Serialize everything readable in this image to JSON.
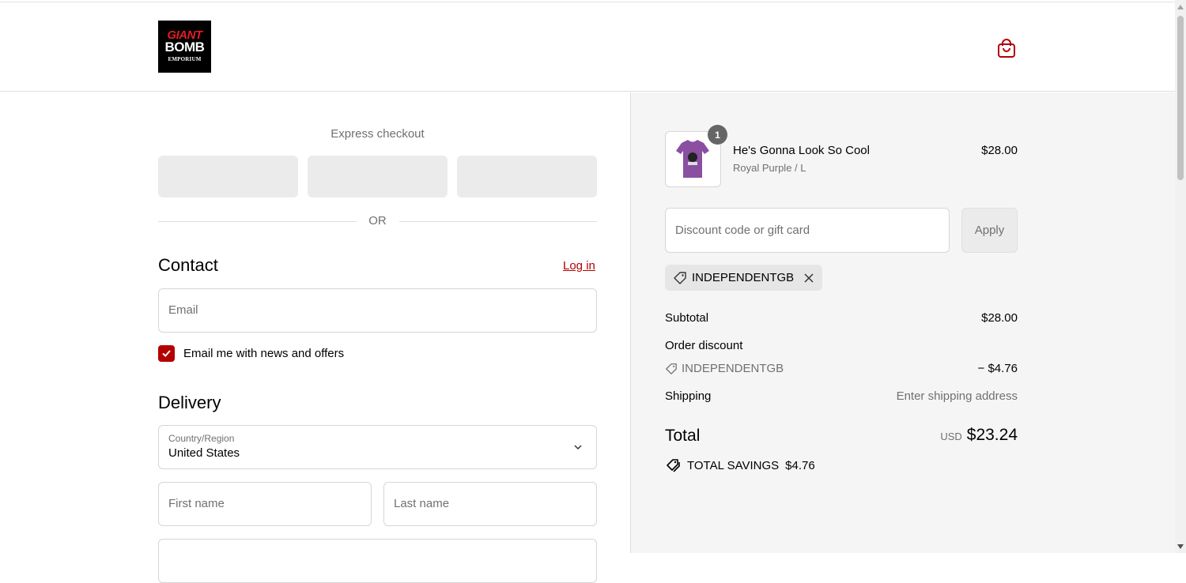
{
  "brand": {
    "logo_line1": "GIANT",
    "logo_line2": "BOMB",
    "logo_line3": "EMPORIUM",
    "accent_color": "#b30000"
  },
  "header": {
    "cart_icon": "shopping-bag-icon"
  },
  "express": {
    "label": "Express checkout",
    "or": "OR"
  },
  "contact": {
    "heading": "Contact",
    "login_label": "Log in",
    "email_placeholder": "Email",
    "newsletter_label": "Email me with news and offers",
    "newsletter_checked": true
  },
  "delivery": {
    "heading": "Delivery",
    "country_label": "Country/Region",
    "country_value": "United States",
    "first_name_placeholder": "First name",
    "last_name_placeholder": "Last name"
  },
  "order": {
    "item": {
      "name": "He's Gonna Look So Cool",
      "variant": "Royal Purple / L",
      "price": "$28.00",
      "quantity": "1"
    },
    "discount_placeholder": "Discount code or gift card",
    "apply_label": "Apply",
    "applied_code": "INDEPENDENTGB",
    "subtotal_label": "Subtotal",
    "subtotal_value": "$28.00",
    "order_discount_label": "Order discount",
    "discount_code": "INDEPENDENTGB",
    "discount_value": "− $4.76",
    "shipping_label": "Shipping",
    "shipping_value": "Enter shipping address",
    "total_label": "Total",
    "total_currency": "USD",
    "total_value": "$23.24",
    "savings_label": "TOTAL SAVINGS",
    "savings_value": "$4.76"
  }
}
